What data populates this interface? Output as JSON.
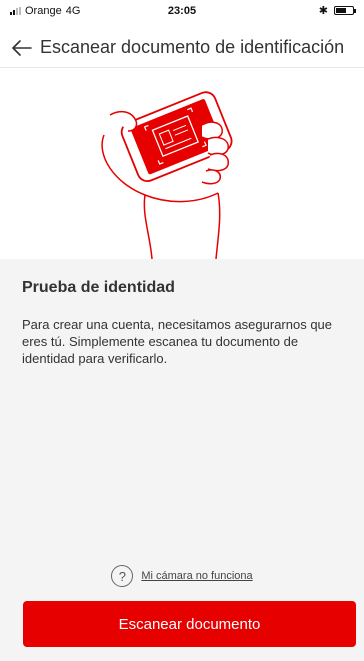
{
  "status_bar": {
    "carrier": "Orange",
    "network": "4G",
    "time": "23:05",
    "bluetooth_glyph": "✱",
    "battery_level": 0.55
  },
  "header": {
    "title": "Escanear documento de identificación",
    "back_icon": "arrow-left-icon"
  },
  "illustration": {
    "accent": "#e60000",
    "icon": "hand-holding-phone-id-icon"
  },
  "content": {
    "heading": "Prueba de identidad",
    "description": "Para crear una cuenta, necesitamos asegurarnos que eres tú. Simplemente escanea tu documento de identidad para verificarlo."
  },
  "help": {
    "icon_glyph": "?",
    "link_label": "Mi cámara no funciona"
  },
  "actions": {
    "scan_label": "Escanear documento"
  },
  "colors": {
    "brand_red": "#e60000",
    "panel_bg": "#f4f4f4"
  }
}
